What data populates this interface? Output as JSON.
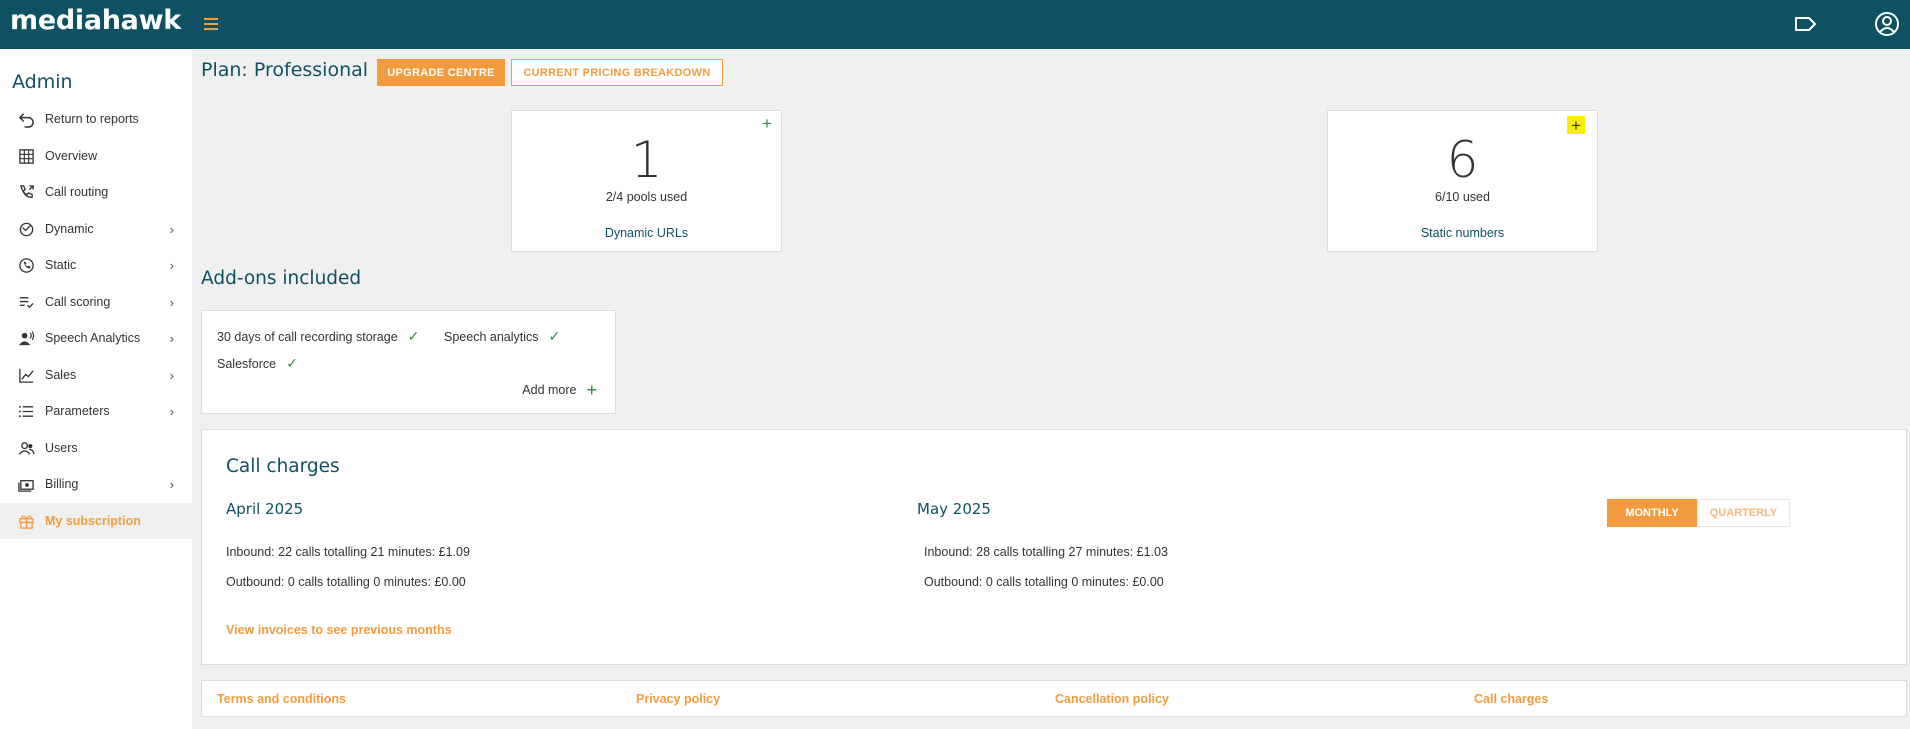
{
  "app": {
    "logo": "mediahawk"
  },
  "topbar": {
    "icons": [
      "menu-icon",
      "tag-icon",
      "user-account-icon"
    ]
  },
  "sidebar": {
    "title": "Admin",
    "items": [
      {
        "label": "Return to reports",
        "icon": "return-icon",
        "chevron": false
      },
      {
        "label": "Overview",
        "icon": "grid-icon",
        "chevron": false
      },
      {
        "label": "Call routing",
        "icon": "phone-forward-icon",
        "chevron": false
      },
      {
        "label": "Dynamic",
        "icon": "dynamic-icon",
        "chevron": true
      },
      {
        "label": "Static",
        "icon": "phone-icon",
        "chevron": true
      },
      {
        "label": "Call scoring",
        "icon": "list-check-icon",
        "chevron": true
      },
      {
        "label": "Speech Analytics",
        "icon": "speaker-icon",
        "chevron": true
      },
      {
        "label": "Sales",
        "icon": "line-chart-icon",
        "chevron": true
      },
      {
        "label": "Parameters",
        "icon": "list-icon",
        "chevron": true
      },
      {
        "label": "Users",
        "icon": "users-icon",
        "chevron": false
      },
      {
        "label": "Billing",
        "icon": "billing-icon",
        "chevron": true
      },
      {
        "label": "My subscription",
        "icon": "gift-icon",
        "chevron": false,
        "active": true
      }
    ],
    "chevron_glyph": "›"
  },
  "header": {
    "plan_title": "Plan: Professional",
    "upgrade_label": "UPGRADE CENTRE",
    "pricing_label": "CURRENT PRICING BREAKDOWN"
  },
  "cards": [
    {
      "number": "1",
      "sub": "2/4 pools used",
      "link": "Dynamic URLs",
      "plus": "+"
    },
    {
      "number": "6",
      "sub": "6/10 used",
      "link": "Static numbers",
      "plus": "+"
    }
  ],
  "addons": {
    "title": "Add-ons included",
    "items": [
      "30 days of call recording storage",
      "Speech analytics",
      "Salesforce"
    ],
    "check": "✓",
    "add_more": "Add more",
    "add_more_plus": "+"
  },
  "charges": {
    "title": "Call charges",
    "months": [
      {
        "name": "April 2025",
        "inbound": "Inbound: 22 calls totalling 21 minutes: £1.09",
        "outbound": "Outbound: 0 calls totalling 0 minutes: £0.00"
      },
      {
        "name": "May 2025",
        "inbound": "Inbound: 28 calls totalling 27 minutes: £1.03",
        "outbound": "Outbound: 0 calls totalling 0 minutes: £0.00"
      }
    ],
    "view_invoices": "View invoices to see previous months",
    "toggle": {
      "monthly": "MONTHLY",
      "quarterly": "QUARTERLY",
      "selected": "MONTHLY"
    }
  },
  "footer": {
    "links": [
      "Terms and conditions",
      "Privacy policy",
      "Cancellation policy",
      "Call charges"
    ]
  },
  "colors": {
    "header_bg": "#0e5163",
    "accent": "#f39c3f",
    "success": "#2e8b3a",
    "highlight": "#f7f000"
  }
}
